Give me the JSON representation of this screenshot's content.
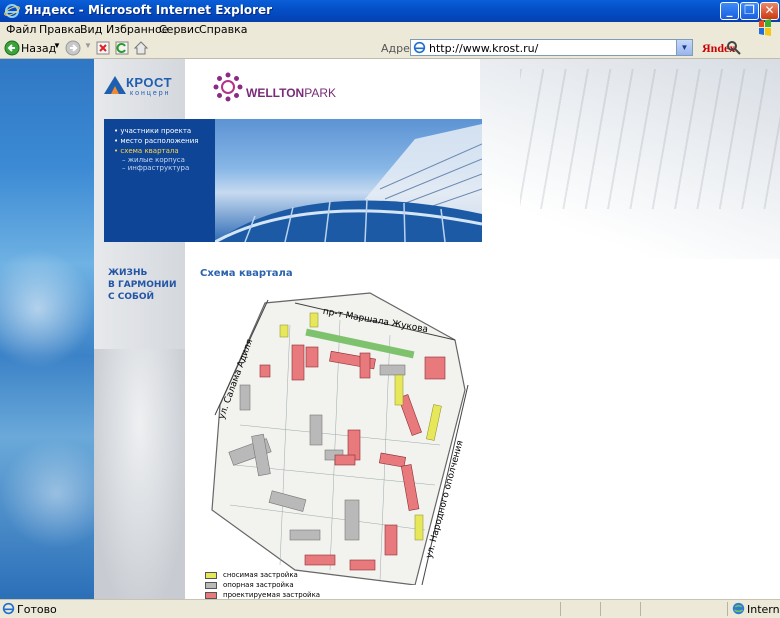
{
  "window": {
    "title": "Яндекс - Microsoft Internet Explorer"
  },
  "menu": {
    "items": [
      "Файл",
      "Правка",
      "Вид",
      "Избранное",
      "Сервис",
      "Справка"
    ]
  },
  "toolbar": {
    "back_label": "Назад",
    "address_label": "Адрес:",
    "url": "http://www.krost.ru/",
    "search_brand": "Яndex",
    "icons": [
      "back-arrow-icon",
      "forward-arrow-icon",
      "stop-icon",
      "refresh-icon",
      "home-icon",
      "search-icon"
    ]
  },
  "page": {
    "logos": {
      "krost_name": "КРОСТ",
      "krost_sub": "концерн",
      "welton_name_bold": "WELLTON",
      "welton_name_rest": "PARK"
    },
    "nav": {
      "items": [
        {
          "label": "• участники проекта",
          "level": 1,
          "active": false
        },
        {
          "label": "• место расположения",
          "level": 1,
          "active": false
        },
        {
          "label": "• схема квартала",
          "level": 1,
          "active": true
        },
        {
          "label": "– жилые корпуса",
          "level": 2,
          "active": false
        },
        {
          "label": "– инфраструктура",
          "level": 2,
          "active": false
        }
      ]
    },
    "slogan": [
      "ЖИЗНЬ",
      "В ГАРМОНИИ",
      "С СОБОЙ"
    ],
    "section_title": "Схема квартала",
    "map": {
      "streets": {
        "top": "пр-т Маршала Жукова",
        "left": "ул. Салама Адиля",
        "right": "ул. Народного ополчения"
      }
    },
    "legend": [
      {
        "label": "сносимая застройка",
        "color": "#e6e85a"
      },
      {
        "label": "опорная застройка",
        "color": "#b9b9b9"
      },
      {
        "label": "проектируемая застройка",
        "color": "#e8797d"
      }
    ]
  },
  "status": {
    "text": "Готово",
    "zone": "Internet"
  },
  "colors": {
    "titlebar": "#0450c8",
    "banner_nav": "#0f4597",
    "accent_text": "#2255a5",
    "planned": "#e8797d",
    "demolished": "#e6e85a",
    "existing": "#b9b9b9"
  }
}
